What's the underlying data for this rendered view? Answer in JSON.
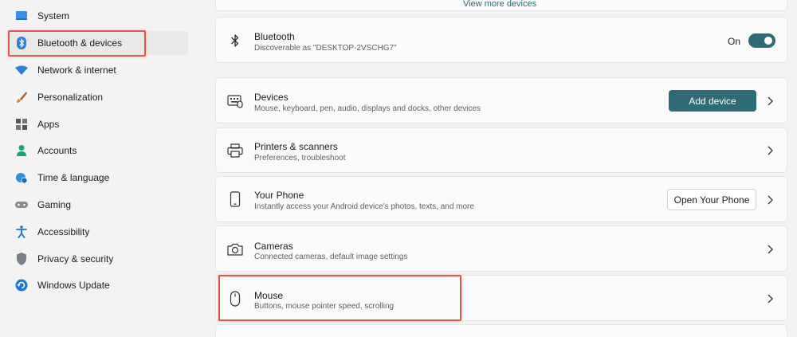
{
  "sidebar": {
    "items": [
      {
        "label": "System",
        "icon": "monitor-icon"
      },
      {
        "label": "Bluetooth & devices",
        "icon": "bluetooth-icon",
        "selected": true
      },
      {
        "label": "Network & internet",
        "icon": "wifi-icon"
      },
      {
        "label": "Personalization",
        "icon": "brush-icon"
      },
      {
        "label": "Apps",
        "icon": "apps-icon"
      },
      {
        "label": "Accounts",
        "icon": "person-icon"
      },
      {
        "label": "Time & language",
        "icon": "globe-clock-icon"
      },
      {
        "label": "Gaming",
        "icon": "gamepad-icon"
      },
      {
        "label": "Accessibility",
        "icon": "accessibility-icon"
      },
      {
        "label": "Privacy & security",
        "icon": "shield-icon"
      },
      {
        "label": "Windows Update",
        "icon": "update-icon"
      }
    ]
  },
  "main": {
    "view_more": "View more devices",
    "bluetooth": {
      "title": "Bluetooth",
      "subtitle": "Discoverable as \"DESKTOP-2VSCHG7\"",
      "toggle_label": "On",
      "toggle_on": true
    },
    "devices": {
      "title": "Devices",
      "subtitle": "Mouse, keyboard, pen, audio, displays and docks, other devices",
      "button": "Add device"
    },
    "printers": {
      "title": "Printers & scanners",
      "subtitle": "Preferences, troubleshoot"
    },
    "phone": {
      "title": "Your Phone",
      "subtitle": "Instantly access your Android device's photos, texts, and more",
      "button": "Open Your Phone"
    },
    "cameras": {
      "title": "Cameras",
      "subtitle": "Connected cameras, default image settings"
    },
    "mouse": {
      "title": "Mouse",
      "subtitle": "Buttons, mouse pointer speed, scrolling"
    }
  },
  "colors": {
    "accent": "#2e6a76",
    "highlight": "#e0584b"
  }
}
